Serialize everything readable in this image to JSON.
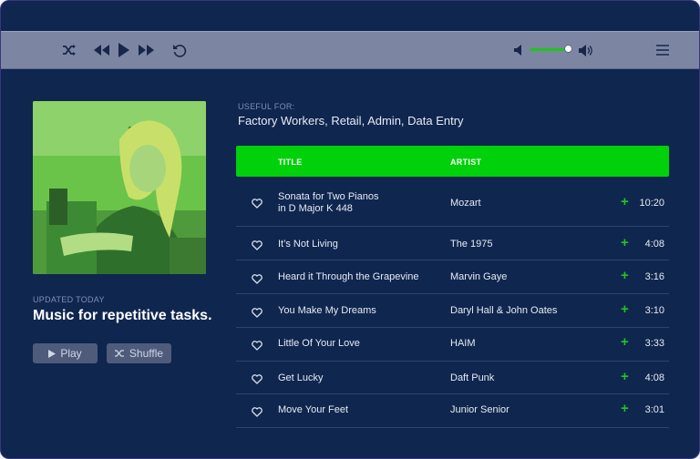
{
  "player": {
    "controls": [
      "shuffle-icon",
      "previous-icon",
      "play-icon",
      "next-icon",
      "repeat-icon"
    ],
    "volume_level": 0.9
  },
  "playlist": {
    "updated_label": "UPDATED TODAY",
    "title": "Music for repetitive tasks.",
    "play_label": "Play",
    "shuffle_label": "Shuffle",
    "useful_for_label": "USEFUL FOR:",
    "useful_for": "Factory Workers, Retail, Admin, Data Entry"
  },
  "table": {
    "headers": {
      "title": "TITLE",
      "artist": "ARTIST"
    },
    "rows": [
      {
        "title_line1": "Sonata for Two Pianos",
        "title_line2": "in D Major K 448",
        "artist": "Mozart",
        "duration": "10:20"
      },
      {
        "title_line1": "It’s Not Living",
        "artist": "The 1975",
        "duration": "4:08"
      },
      {
        "title_line1": "Heard it Through the Grapevine",
        "artist": "Marvin Gaye",
        "duration": "3:16"
      },
      {
        "title_line1": "You Make My Dreams",
        "artist": "Daryl Hall & John Oates",
        "duration": "3:10"
      },
      {
        "title_line1": "Little Of Your Love",
        "artist": "HAIM",
        "duration": "3:33"
      },
      {
        "title_line1": "Get Lucky",
        "artist": "Daft Punk",
        "duration": "4:08"
      },
      {
        "title_line1": "Move Your Feet",
        "artist": "Junior Senior",
        "duration": "3:01"
      }
    ]
  },
  "colors": {
    "background": "#0f264f",
    "topbar": "#7c86a3",
    "accent_green": "#00d10a",
    "text": "#e6ebf5"
  }
}
